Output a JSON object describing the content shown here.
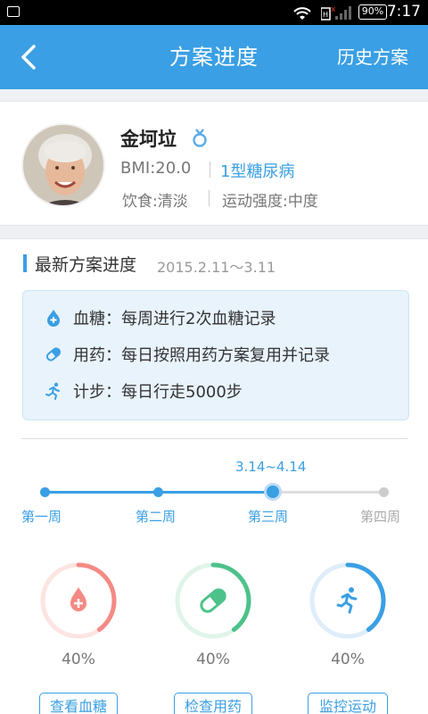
{
  "status_bar": {
    "battery": "90%",
    "time": "7:17"
  },
  "nav": {
    "title": "方案进度",
    "history": "历史方案"
  },
  "profile": {
    "name": "金坷垃",
    "bmi": "BMI:20.0",
    "diabetes_type": "1型糖尿病",
    "diet": "饮食:清淡",
    "exercise": "运动强度:中度"
  },
  "plan": {
    "section_title": "最新方案进度",
    "date_range": "2015.2.11～3.11",
    "items": [
      {
        "icon": "blood-drop-icon",
        "text": "血糖：每周进行2次血糖记录"
      },
      {
        "icon": "pill-icon",
        "text": "用药：每日按照用药方案复用并记录"
      },
      {
        "icon": "running-icon",
        "text": "计步：每日行走5000步"
      }
    ]
  },
  "timeline": {
    "current_range": "3.14~4.14",
    "weeks": [
      "第一周",
      "第二周",
      "第三周",
      "第四周"
    ],
    "current_week_index": 2
  },
  "progress": [
    {
      "icon": "blood-drop-icon",
      "percent_label": "40%",
      "value": 0.4,
      "button": "查看血糖",
      "color": "#f48a85"
    },
    {
      "icon": "pill-icon",
      "percent_label": "40%",
      "value": 0.4,
      "button": "检查用药",
      "color": "#4cc28a"
    },
    {
      "icon": "running-icon",
      "percent_label": "40%",
      "value": 0.4,
      "button": "监控运动",
      "color": "#3a9fe4"
    }
  ],
  "colors": {
    "accent": "#3a9fe4",
    "blood": "#f48a85",
    "medicine": "#4cc28a",
    "exercise": "#3a9fe4"
  }
}
